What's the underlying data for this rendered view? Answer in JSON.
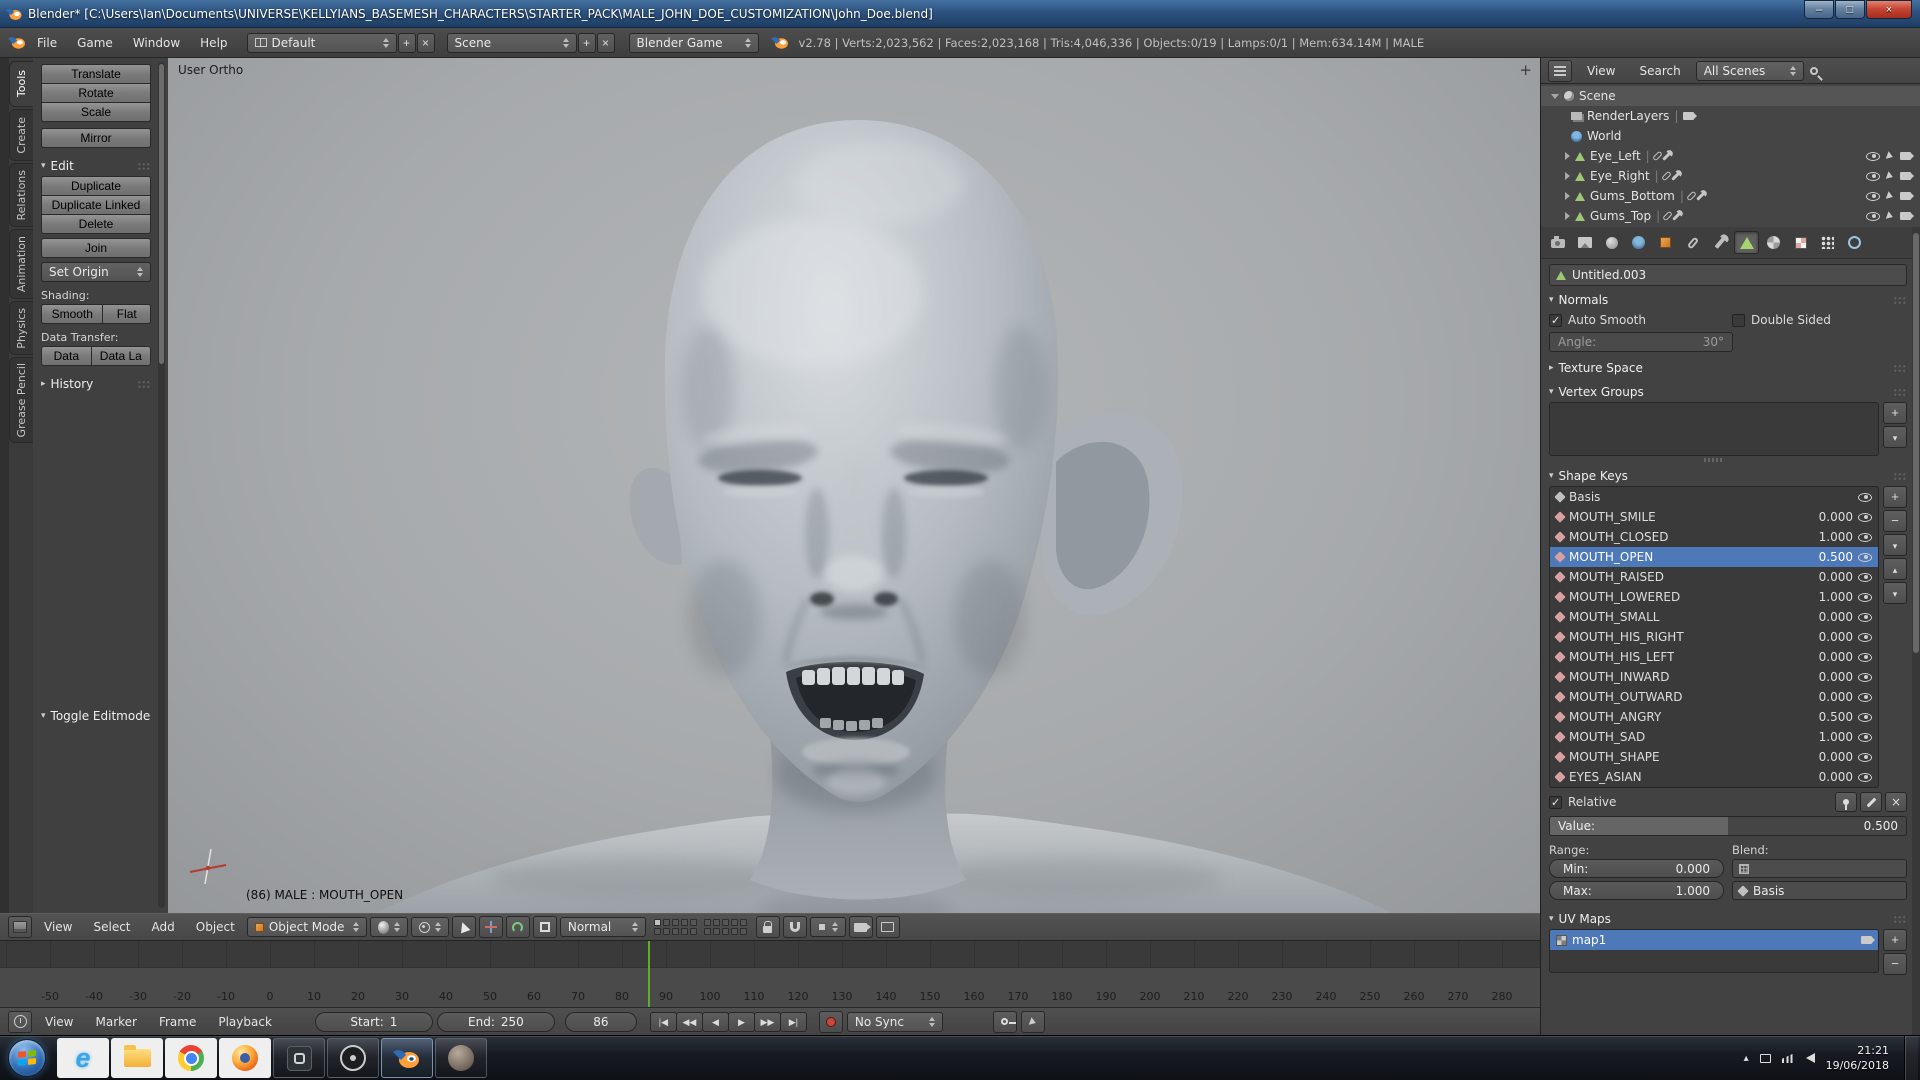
{
  "colors": {
    "selection_blue": "#4d79b8",
    "playhead_green": "#5fae27",
    "blender_orange": "#ff9f3a",
    "titlebar_blue": "#2c5280",
    "close_red": "#c74634"
  },
  "titlebar": {
    "title": "Blender* [C:\\Users\\Ian\\Documents\\UNIVERSE\\KELLYIANS_BASEMESH_CHARACTERS\\STARTER_PACK\\MALE_JOHN_DOE_CUSTOMIZATION\\John_Doe.blend]",
    "controls": {
      "minimize": "–",
      "maximize": "□",
      "close": "×"
    }
  },
  "info_header": {
    "menus": [
      "File",
      "Game",
      "Window",
      "Help"
    ],
    "screen_layout": "Default",
    "scene": "Scene",
    "engine": "Blender Game",
    "stats": "v2.78 | Verts:2,023,562 | Faces:2,023,168 | Tris:4,046,336 | Objects:0/19 | Lamps:0/1 | Mem:634.14M | MALE"
  },
  "tool_shelf": {
    "tabs": [
      {
        "label": "Tools",
        "active": true
      },
      {
        "label": "Create"
      },
      {
        "label": "Relations"
      },
      {
        "label": "Animation"
      },
      {
        "label": "Physics"
      },
      {
        "label": "Grease Pencil"
      }
    ],
    "buttons": {
      "translate": "Translate",
      "rotate": "Rotate",
      "scale": "Scale",
      "mirror": "Mirror",
      "duplicate": "Duplicate",
      "duplicate_linked": "Duplicate Linked",
      "delete": "Delete",
      "join": "Join",
      "set_origin": "Set Origin",
      "smooth": "Smooth",
      "flat": "Flat",
      "data": "Data",
      "data_layout": "Data La"
    },
    "sections": {
      "edit": "Edit",
      "shading_label": "Shading:",
      "data_transfer_label": "Data Transfer:",
      "history": "History",
      "toggle_editmode": "Toggle Editmode"
    }
  },
  "viewport": {
    "view_label": "User Ortho",
    "status_label": "(86) MALE : MOUTH_OPEN",
    "header": {
      "menus": [
        "View",
        "Select",
        "Add",
        "Object"
      ],
      "mode": "Object Mode",
      "orientation": "Normal"
    }
  },
  "timeline": {
    "menus": [
      "View",
      "Marker",
      "Frame",
      "Playback"
    ],
    "start_label": "Start:",
    "start_value": "1",
    "end_label": "End:",
    "end_value": "250",
    "current_frame": "86",
    "playhead_frame": 86,
    "sync": "No Sync",
    "playback_icons": [
      "|◀",
      "◀◀",
      "◀",
      "▶",
      "▶▶",
      "▶|"
    ],
    "ticks": [
      "-50",
      "-40",
      "-30",
      "-20",
      "-10",
      "0",
      "10",
      "20",
      "30",
      "40",
      "50",
      "60",
      "70",
      "80",
      "90",
      "100",
      "110",
      "120",
      "130",
      "140",
      "150",
      "160",
      "170",
      "180",
      "190",
      "200",
      "210",
      "220",
      "230",
      "240",
      "250",
      "260",
      "270",
      "280"
    ]
  },
  "outliner": {
    "menus": [
      "View",
      "Search"
    ],
    "filter": "All Scenes",
    "items": [
      {
        "label": "Scene"
      },
      {
        "label": "RenderLayers"
      },
      {
        "label": "World"
      },
      {
        "label": "Eye_Left"
      },
      {
        "label": "Eye_Right"
      },
      {
        "label": "Gums_Bottom"
      },
      {
        "label": "Gums_Top"
      }
    ]
  },
  "properties": {
    "datablock_name": "Untitled.003",
    "normals": {
      "title": "Normals",
      "auto_smooth": "Auto Smooth",
      "double_sided": "Double Sided",
      "angle_label": "Angle:",
      "angle_value": "30°"
    },
    "texture_space_title": "Texture Space",
    "vertex_groups_title": "Vertex Groups",
    "shape_keys": {
      "title": "Shape Keys",
      "items": [
        {
          "name": "Basis",
          "value": ""
        },
        {
          "name": "MOUTH_SMILE",
          "value": "0.000"
        },
        {
          "name": "MOUTH_CLOSED",
          "value": "1.000"
        },
        {
          "name": "MOUTH_OPEN",
          "value": "0.500",
          "selected": true
        },
        {
          "name": "MOUTH_RAISED",
          "value": "0.000"
        },
        {
          "name": "MOUTH_LOWERED",
          "value": "1.000"
        },
        {
          "name": "MOUTH_SMALL",
          "value": "0.000"
        },
        {
          "name": "MOUTH_HIS_RIGHT",
          "value": "0.000"
        },
        {
          "name": "MOUTH_HIS_LEFT",
          "value": "0.000"
        },
        {
          "name": "MOUTH_INWARD",
          "value": "0.000"
        },
        {
          "name": "MOUTH_OUTWARD",
          "value": "0.000"
        },
        {
          "name": "MOUTH_ANGRY",
          "value": "0.500"
        },
        {
          "name": "MOUTH_SAD",
          "value": "1.000"
        },
        {
          "name": "MOUTH_SHAPE",
          "value": "0.000"
        },
        {
          "name": "EYES_ASIAN",
          "value": "0.000"
        }
      ],
      "relative_label": "Relative",
      "value_label": "Value:",
      "value": "0.500",
      "range_label": "Range:",
      "blend_label": "Blend:",
      "min_label": "Min:",
      "min_value": "0.000",
      "max_label": "Max:",
      "max_value": "1.000",
      "blend_value": "Basis"
    },
    "uv_maps": {
      "title": "UV Maps",
      "items": [
        {
          "name": "map1",
          "selected": true
        }
      ]
    }
  },
  "taskbar": {
    "clock_time": "21:21",
    "clock_date": "19/06/2018"
  }
}
